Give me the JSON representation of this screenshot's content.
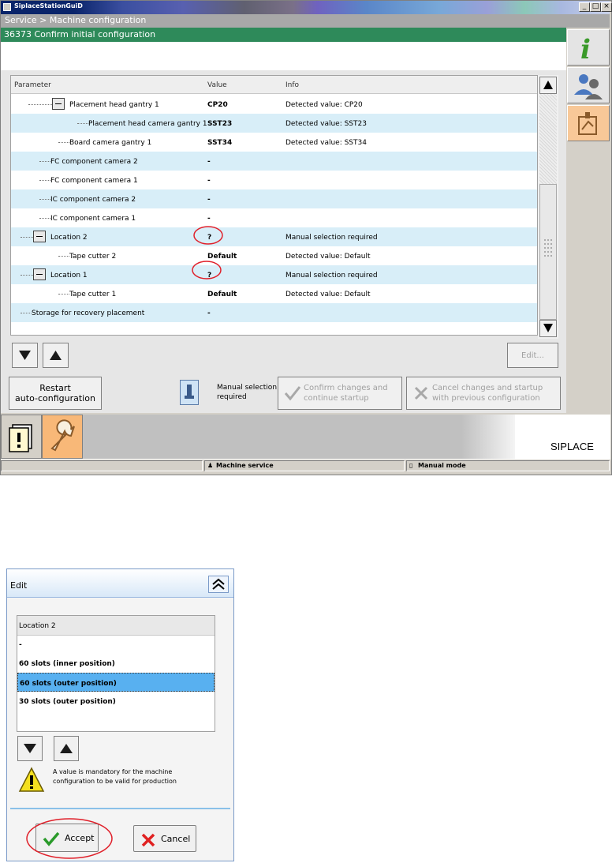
{
  "window": {
    "title": "SiplaceStationGuiD",
    "breadcrumb": "Service > Machine configuration",
    "dialog_title": "36373 Confirm initial configuration"
  },
  "table": {
    "headers": {
      "parameter": "Parameter",
      "value": "Value",
      "info": "Info"
    },
    "rows": [
      {
        "param": "Placement head gantry 1",
        "value": "CP20",
        "info": "Detected value: CP20"
      },
      {
        "param": "Placement head camera gantry 1",
        "value": "SST23",
        "info": "Detected value: SST23"
      },
      {
        "param": "Board camera gantry 1",
        "value": "SST34",
        "info": "Detected value: SST34"
      },
      {
        "param": "FC component camera 2",
        "value": "-",
        "info": ""
      },
      {
        "param": "FC component camera 1",
        "value": "-",
        "info": ""
      },
      {
        "param": "IC component camera 2",
        "value": "-",
        "info": ""
      },
      {
        "param": "IC component camera 1",
        "value": "-",
        "info": ""
      },
      {
        "param": "Location 2",
        "value": "?",
        "info": "Manual selection required"
      },
      {
        "param": "Tape cutter 2",
        "value": "Default",
        "info": "Detected value: Default"
      },
      {
        "param": "Location 1",
        "value": "?",
        "info": "Manual selection required"
      },
      {
        "param": "Tape cutter 1",
        "value": "Default",
        "info": "Detected value: Default"
      },
      {
        "param": "Storage for recovery placement",
        "value": "-",
        "info": ""
      }
    ]
  },
  "buttons": {
    "edit": "Edit...",
    "restart_line1": "Restart",
    "restart_line2": "auto-configuration",
    "confirm_line1": "Confirm changes and",
    "confirm_line2": "continue startup",
    "cancel_line1": "Cancel changes and startup",
    "cancel_line2": "with previous configuration"
  },
  "legend": {
    "line1": "Manual selection",
    "line2": "required"
  },
  "brand": "SIPLACE",
  "status": {
    "service": "Machine service",
    "mode": "Manual mode"
  },
  "edit_dialog": {
    "title": "Edit",
    "list_header": "Location 2",
    "options": [
      "-",
      "60 slots (inner position)",
      "60 slots (outer position)",
      "30 slots (outer position)"
    ],
    "selected_index": 2,
    "warning_line1": "A value is mandatory for the machine",
    "warning_line2": "configuration to be valid for production",
    "accept": "Accept",
    "cancel": "Cancel"
  },
  "colors": {
    "accent_green": "#2e8a5a",
    "annotation_red": "#e0202a",
    "selection_blue": "#58b0f0"
  }
}
